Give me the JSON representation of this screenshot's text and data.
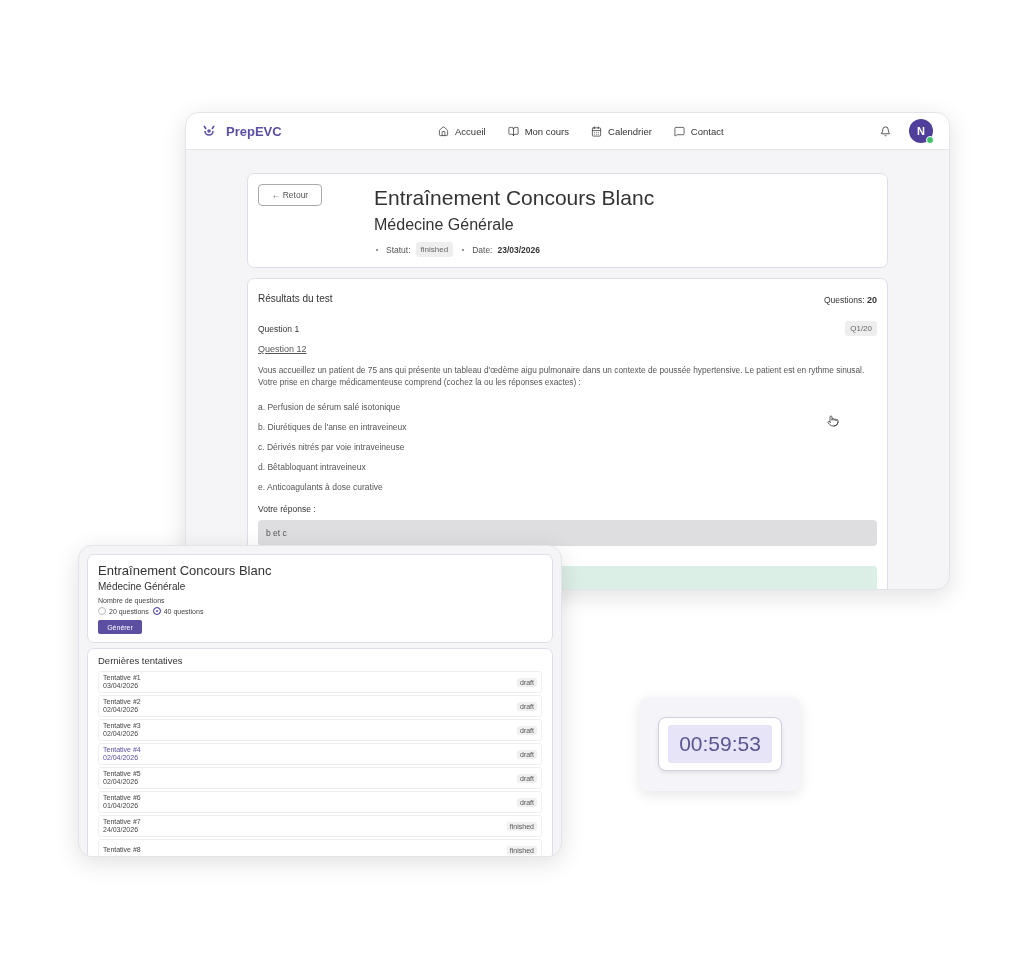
{
  "main_window": {
    "logo": "PrepEVC",
    "nav": [
      {
        "label": "Accueil"
      },
      {
        "label": "Mon cours"
      },
      {
        "label": "Calendrier"
      },
      {
        "label": "Contact"
      }
    ],
    "avatar": "N",
    "exam": {
      "back": "← Retour",
      "title": "Entraînement Concours Blanc",
      "subtitle": "Médecine Générale",
      "status_label": "Statut:",
      "status": "finished",
      "date_label": "Date:",
      "date": "23/03/2026"
    },
    "results": {
      "title": "Résultats du test",
      "count_label": "Questions:",
      "count": "20",
      "question": {
        "heading": "Question 1",
        "badge": "Q1/20",
        "link": "Question 12",
        "text": "Vous accueillez un patient de 75 ans qui présente un tableau d'œdème aigu pulmonaire dans un contexte de poussée hypertensive. Le patient est en rythme sinusal. Votre prise en charge médicamenteuse comprend (cochez la ou les réponses exactes) :",
        "options": [
          "a. Perfusion de sérum salé isotonique",
          "b. Diurétiques de l'anse en intraveineux",
          "c. Dérivés nitrés par voie intraveineuse",
          "d. Bêtabloquant intraveineux",
          "e. Anticoagulants à dose curative"
        ],
        "answer_label": "Votre réponse :",
        "answer": "b et c"
      }
    }
  },
  "generator_window": {
    "title": "Entraînement Concours Blanc",
    "subtitle": "Médecine Générale",
    "count_label": "Nombre de questions",
    "options": [
      {
        "label": "20 questions",
        "selected": false
      },
      {
        "label": "40 questions",
        "selected": true
      }
    ],
    "button": "Générer",
    "attempts_title": "Dernières tentatives",
    "attempts": [
      {
        "name": "Tentative #1",
        "date": "03/04/2026",
        "status": "draft",
        "hovered": false
      },
      {
        "name": "Tentative #2",
        "date": "02/04/2026",
        "status": "draft",
        "hovered": false
      },
      {
        "name": "Tentative #3",
        "date": "02/04/2026",
        "status": "draft",
        "hovered": false
      },
      {
        "name": "Tentative #4",
        "date": "02/04/2026",
        "status": "draft",
        "hovered": true
      },
      {
        "name": "Tentative #5",
        "date": "02/04/2026",
        "status": "draft",
        "hovered": false
      },
      {
        "name": "Tentative #6",
        "date": "01/04/2026",
        "status": "draft",
        "hovered": false
      },
      {
        "name": "Tentative #7",
        "date": "24/03/2026",
        "status": "finished",
        "hovered": false
      },
      {
        "name": "Tentative #8",
        "status": "finished",
        "hovered": false
      }
    ]
  },
  "timer": "00:59:53"
}
